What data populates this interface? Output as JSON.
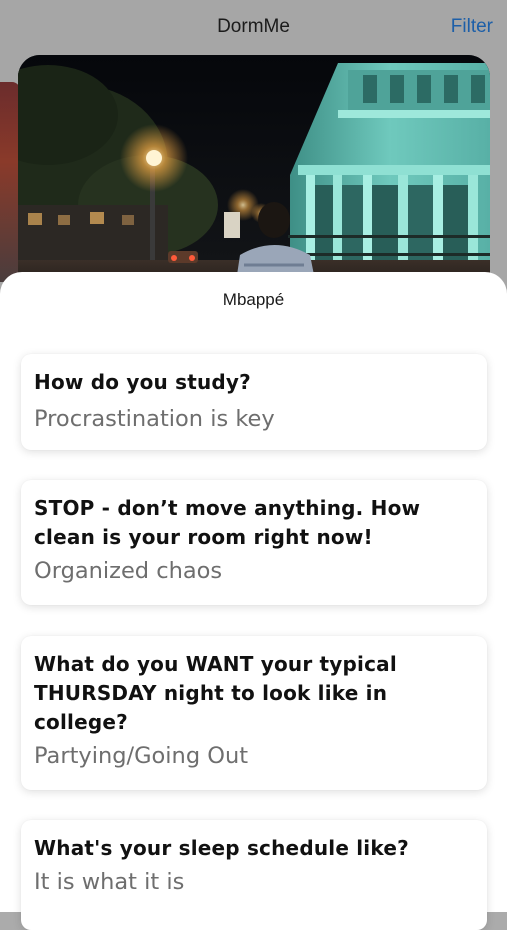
{
  "nav": {
    "title": "DormMe",
    "filter_label": "Filter"
  },
  "profile": {
    "name": "Mbappé"
  },
  "questions": [
    {
      "question": "How do you study?",
      "answer": "Procrastination is key"
    },
    {
      "question": "STOP - don’t move anything. How clean is your room right now!",
      "answer": "Organized chaos"
    },
    {
      "question": "What do you WANT your typical THURSDAY night to look like in college?",
      "answer": "Partying/Going Out"
    },
    {
      "question": "What's your sleep schedule like?",
      "answer": "It is what it is"
    }
  ],
  "colors": {
    "accent": "#1d5fa8",
    "overlay": "#a6a6a6",
    "answer_text": "#6e6e6e"
  }
}
